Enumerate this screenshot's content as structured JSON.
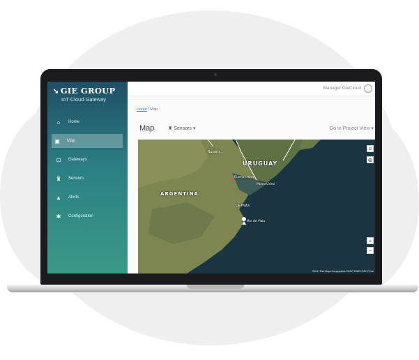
{
  "brand": {
    "name": "GIE GROUP",
    "subtitle": "IoT Cloud Gateway"
  },
  "sidebar": {
    "items": [
      {
        "icon": "home-icon",
        "label": "Home",
        "active": false
      },
      {
        "icon": "map-icon",
        "label": "Map",
        "active": true
      },
      {
        "icon": "gateways-icon",
        "label": "Gateways",
        "active": false
      },
      {
        "icon": "sensors-icon",
        "label": "Sensors",
        "active": false
      },
      {
        "icon": "alerts-icon",
        "label": "Alerts",
        "active": false
      },
      {
        "icon": "configuration-icon",
        "label": "Configuration",
        "active": false
      }
    ]
  },
  "header": {
    "user": "Manager GieCloud"
  },
  "breadcrumb": {
    "home": "Home",
    "separator": "/",
    "current": "Map"
  },
  "page": {
    "title": "Map",
    "sensors_dropdown": "Sensors",
    "project_view": "Go to Project View"
  },
  "map": {
    "labels": {
      "country_1": "URUGUAY",
      "country_2": "ARGENTINA",
      "city_1": "Rosario",
      "city_2": "Buenos Aires",
      "city_3": "Montevideo",
      "city_4": "La Plata",
      "city_5": "Mar del Plata"
    },
    "attribution": "©2017 Esri Maps Geographics ©2017 CNES ©2017 Esri"
  },
  "colors": {
    "sidebar_top": "#1f4f66",
    "sidebar_bottom": "#3a9a88",
    "link": "#3a7db2",
    "ocean": "#1a3340"
  }
}
